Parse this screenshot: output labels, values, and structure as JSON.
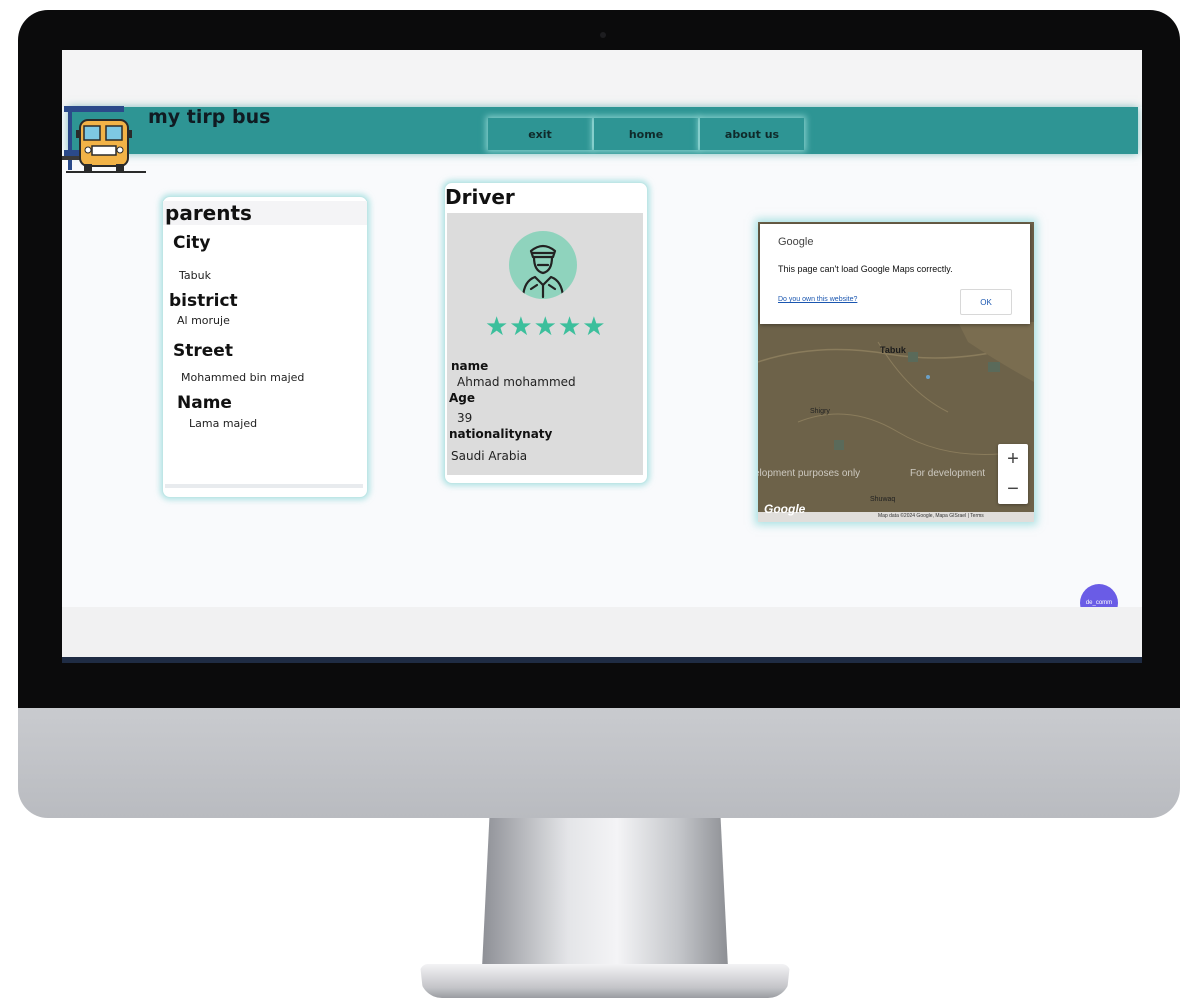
{
  "site": {
    "title": "my tirp bus"
  },
  "nav": {
    "items": [
      "exit",
      "home",
      "about us"
    ]
  },
  "parents": {
    "title": "parents",
    "fields": [
      {
        "label": "City",
        "value": "Tabuk"
      },
      {
        "label": "bistrict",
        "value": "Al moruje"
      },
      {
        "label": "Street",
        "value": "Mohammed bin majed"
      },
      {
        "label": "Name",
        "value": "Lama majed"
      }
    ]
  },
  "driver": {
    "title": "Driver",
    "rating_stars": "★★★★★",
    "rating": 5,
    "fields": [
      {
        "label": "name",
        "value": "Ahmad mohammed"
      },
      {
        "label": "Age",
        "value": "39"
      },
      {
        "label": "nationalitynaty",
        "value": "Saudi Arabia"
      }
    ]
  },
  "map": {
    "dialog_title": "Google",
    "dialog_message": "This page can't load Google Maps correctly.",
    "dialog_link": "Do you own this website?",
    "ok_label": "OK",
    "city_label": "Tabuk",
    "place_label": "Shigry",
    "place_label2": "Shuwaq",
    "watermark": "elopment purposes only",
    "watermark2": "For development",
    "zoom_in": "+",
    "zoom_out": "−",
    "logo": "Google",
    "attribution": "Map data ©2024 Google, Mapa GISrael | Terms"
  },
  "chat": {
    "label": "de_comm"
  },
  "colors": {
    "header": "#2e9594",
    "accent": "#3cbf9c",
    "chat": "#6a5ce6"
  }
}
